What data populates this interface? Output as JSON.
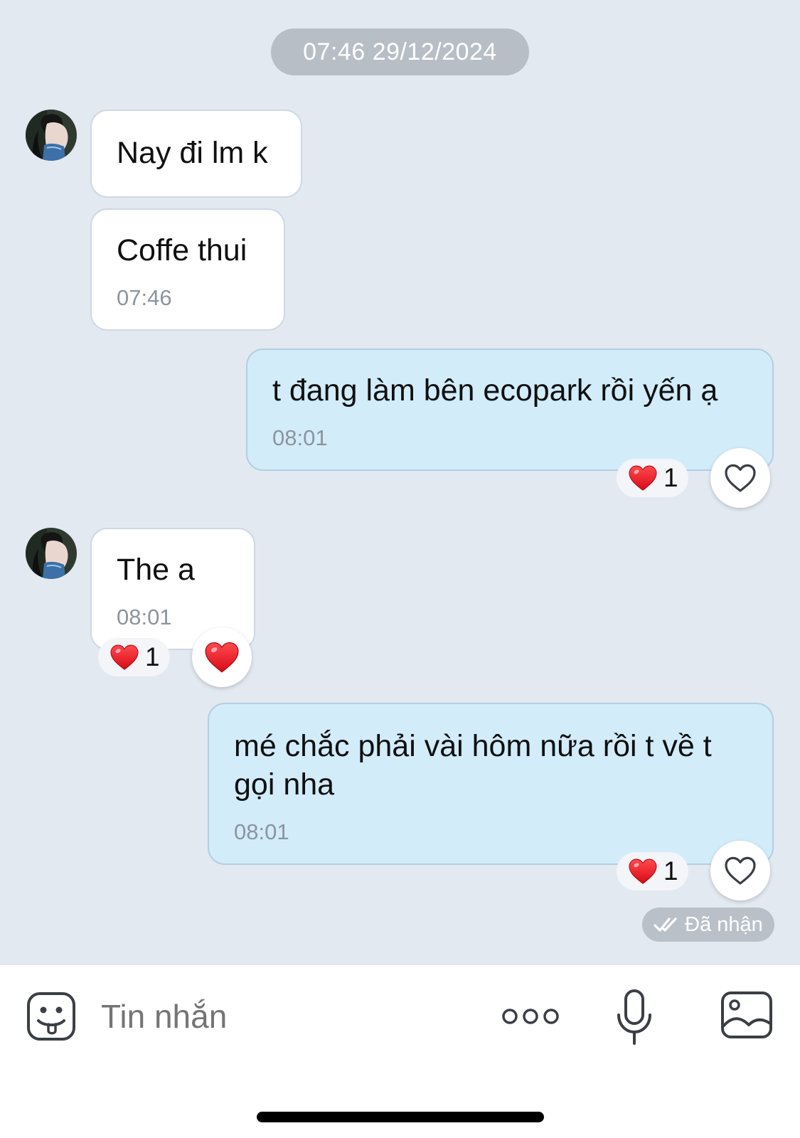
{
  "date_separator": "07:46 29/12/2024",
  "messages": [
    {
      "direction": "in",
      "text": "Nay đi lm k"
    },
    {
      "direction": "in",
      "text": "Coffe thui",
      "time": "07:46"
    },
    {
      "direction": "out",
      "text": "t đang làm bên ecopark rồi yến ạ",
      "time": "08:01",
      "reaction": {
        "emoji": "heart",
        "count": "1"
      }
    },
    {
      "direction": "in",
      "text": "The a",
      "time": "08:01",
      "reaction": {
        "emoji": "heart",
        "count": "1"
      }
    },
    {
      "direction": "out",
      "text_lines": [
        "mé chắc phải vài hôm nữa rồi t về t",
        "gọi nha"
      ],
      "time": "08:01",
      "reaction": {
        "emoji": "heart",
        "count": "1"
      }
    }
  ],
  "delivery_status": "Đã nhận",
  "composer": {
    "placeholder": "Tin nhắn",
    "icons": [
      "sticker-icon",
      "more-icon",
      "microphone-icon",
      "image-icon"
    ]
  },
  "colors": {
    "background": "#e2e9f1",
    "incoming_bubble": "#ffffff",
    "outgoing_bubble": "#d2ecfa",
    "heart": "#e8141f"
  }
}
